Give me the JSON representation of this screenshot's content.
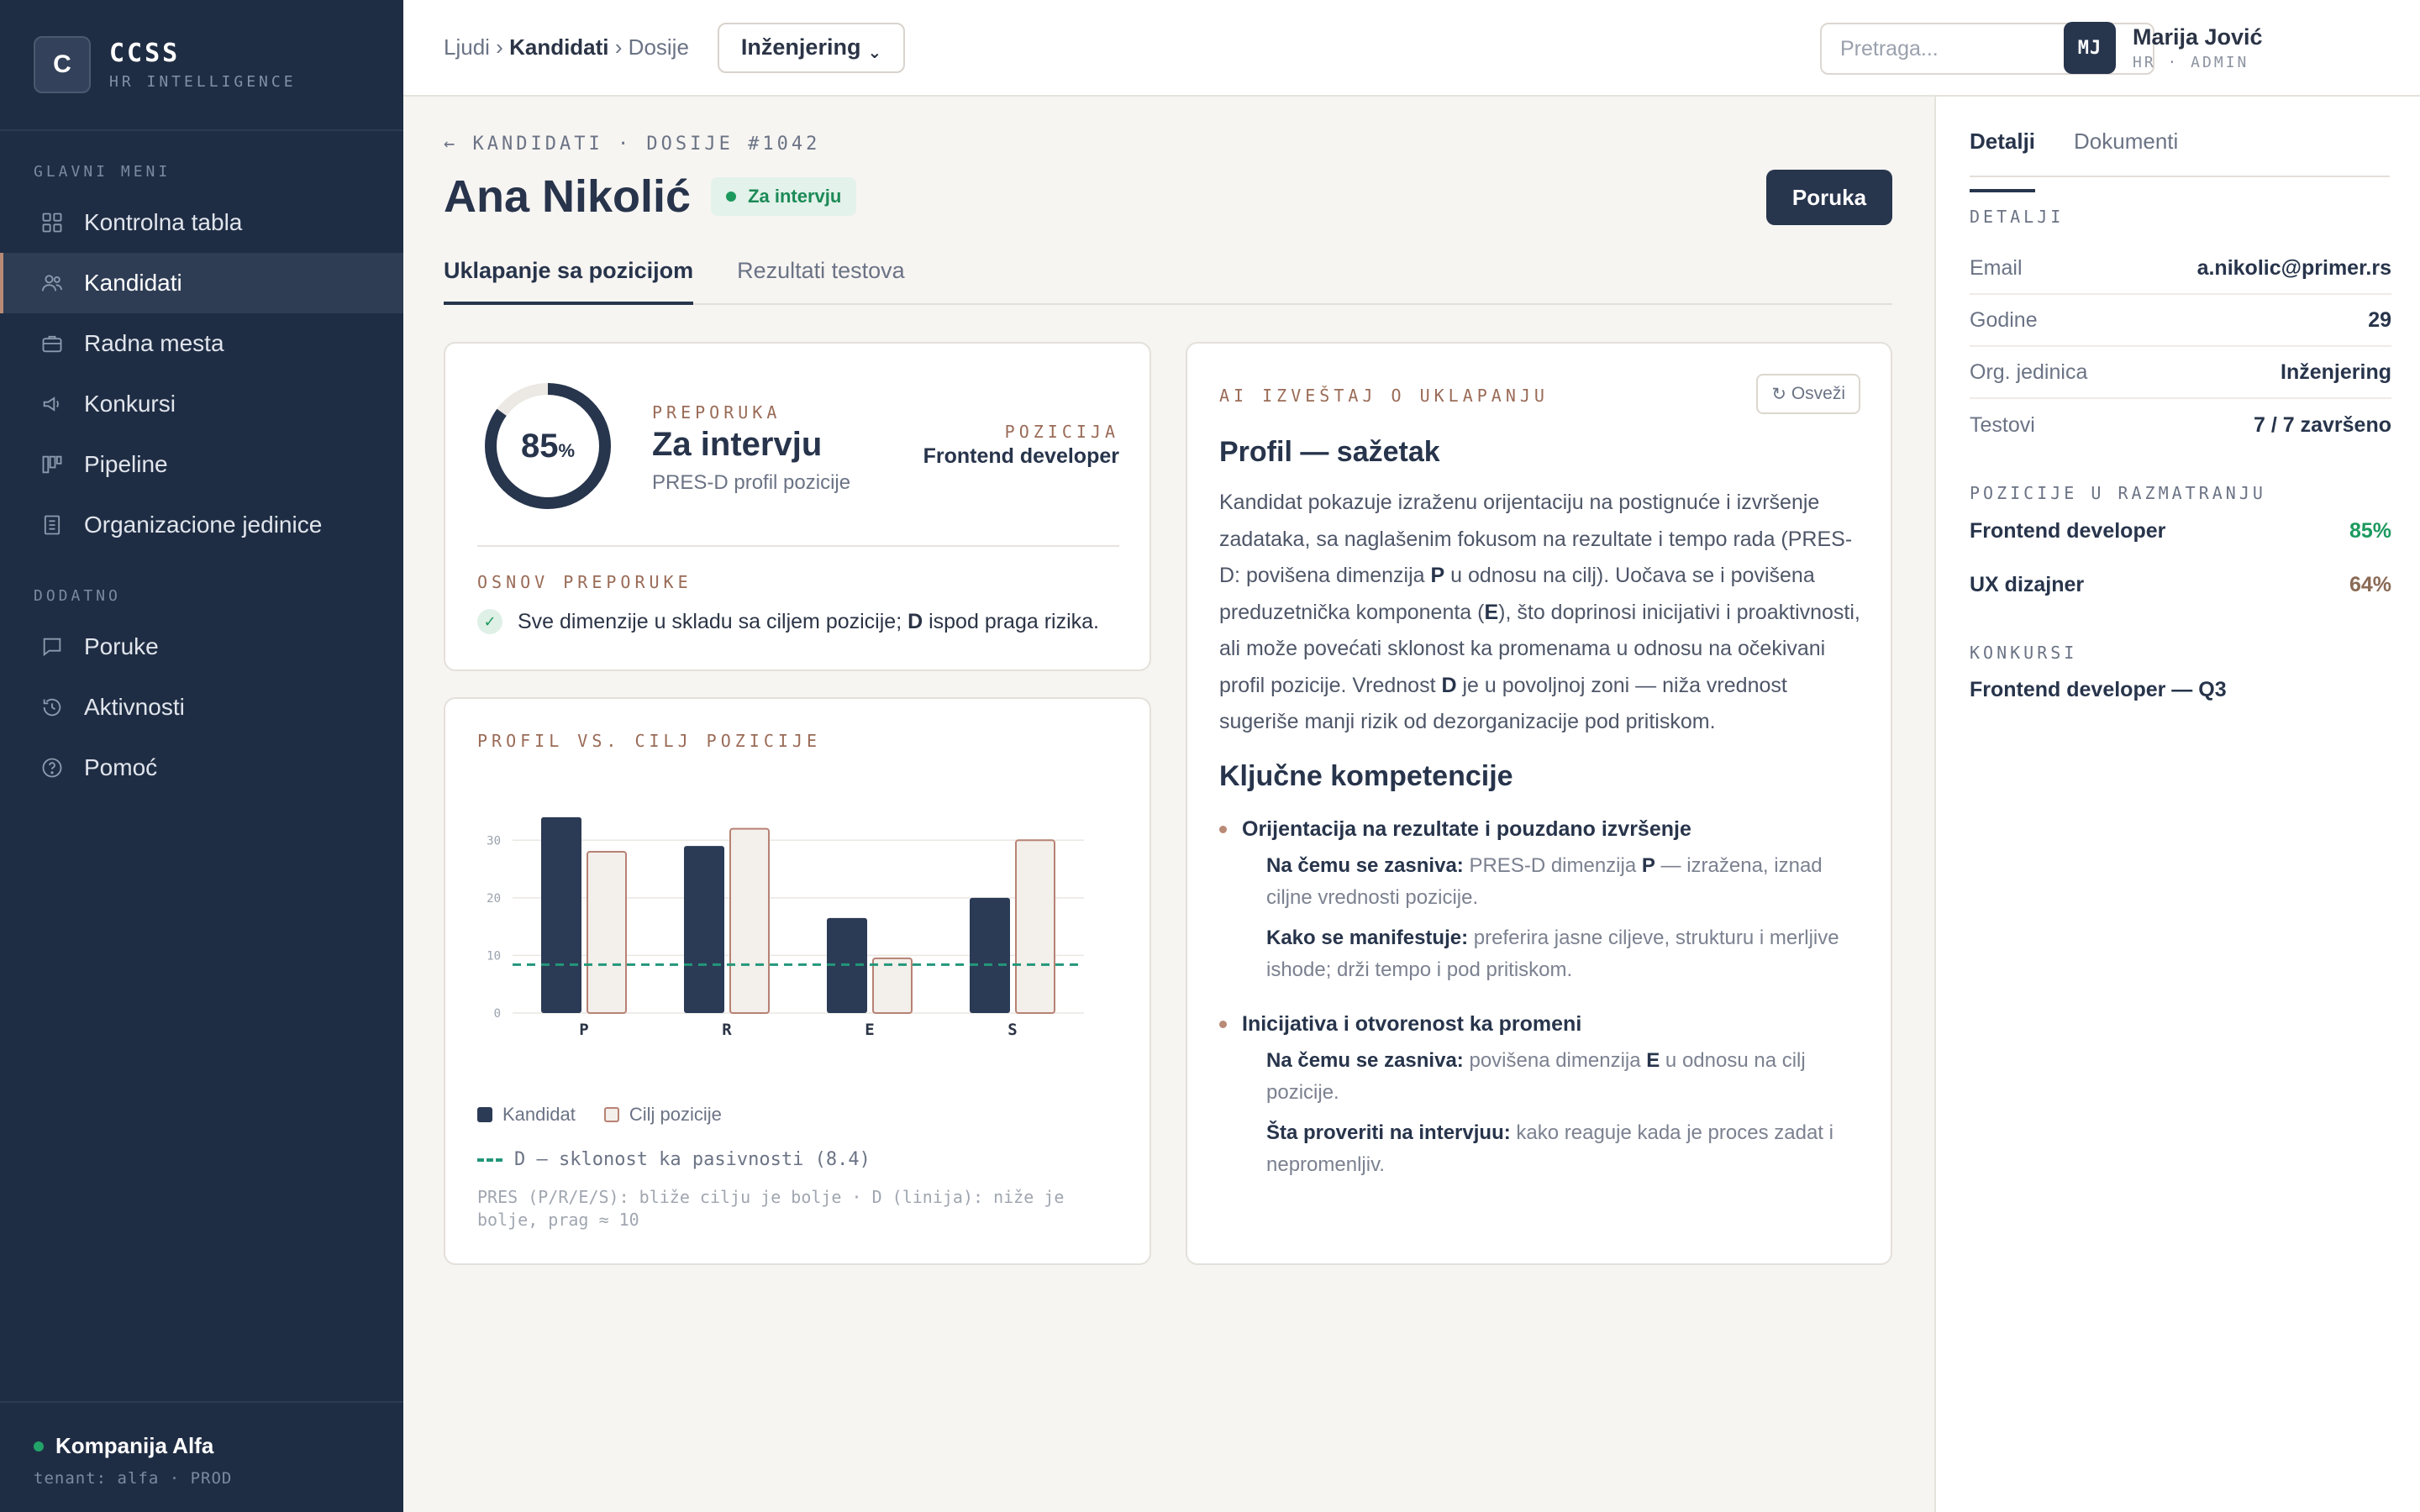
{
  "brand": {
    "logo_letter": "C",
    "name": "CCSS",
    "subtitle": "HR INTELLIGENCE"
  },
  "sidebar": {
    "section_main": "GLAVNI MENI",
    "main_items": [
      {
        "label": "Kontrolna tabla",
        "icon": "grid-icon"
      },
      {
        "label": "Kandidati",
        "icon": "users-icon",
        "active": true
      },
      {
        "label": "Radna mesta",
        "icon": "briefcase-icon"
      },
      {
        "label": "Konkursi",
        "icon": "megaphone-icon"
      },
      {
        "label": "Pipeline",
        "icon": "kanban-icon"
      },
      {
        "label": "Organizacione jedinice",
        "icon": "building-icon"
      }
    ],
    "section_extra": "DODATNO",
    "extra_items": [
      {
        "label": "Poruke",
        "icon": "message-icon"
      },
      {
        "label": "Aktivnosti",
        "icon": "history-icon"
      },
      {
        "label": "Pomoć",
        "icon": "help-icon"
      }
    ],
    "company": "Kompanija Alfa",
    "tenant": "tenant: alfa · PROD"
  },
  "topbar": {
    "crumb_1": "Ljudi",
    "crumb_2": "Kandidati",
    "crumb_3": "Dosije",
    "sep": "›",
    "department": "Inženjering",
    "search_placeholder": "Pretraga...",
    "user_initials": "MJ",
    "user_name": "Marija Jović",
    "user_role": "HR · ADMIN"
  },
  "header": {
    "back_line": "← KANDIDATI · DOSIJE #1042",
    "name": "Ana Nikolić",
    "status": "Za intervju",
    "message_button": "Poruka",
    "tabs": [
      "Uklapanje sa pozicijom",
      "Rezultati testova"
    ]
  },
  "recommendation": {
    "score": 85,
    "score_unit": "%",
    "label": "PREPORUKA",
    "value": "Za intervju",
    "profile": "PRES-D profil pozicije",
    "position_label": "POZICIJA",
    "position_value": "Frontend developer",
    "basis_label": "OSNOV PREPORUKE",
    "basis_text_1": "Sve dimenzije u skladu sa ciljem pozicije; ",
    "basis_bold": "D",
    "basis_text_2": " ispod praga rizika."
  },
  "chart_data": {
    "type": "bar",
    "title": "PROFIL VS. CILJ POZICIJE",
    "categories": [
      "P",
      "R",
      "E",
      "S"
    ],
    "series": [
      {
        "name": "Kandidat",
        "values": [
          34,
          29,
          16.5,
          20
        ]
      },
      {
        "name": "Cilj pozicije",
        "values": [
          28,
          32,
          9.5,
          30
        ]
      }
    ],
    "reference_line": {
      "name": "D — sklonost ka pasivnosti (8.4)",
      "value": 8.4
    },
    "yticks": [
      0,
      10,
      20,
      30
    ],
    "ylim": [
      0,
      35
    ],
    "grid": true,
    "legend_position": "bottom",
    "note": "PRES (P/R/E/S): bliže cilju je bolje · D (linija): niže je bolje, prag ≈ 10",
    "colors": {
      "candidate": "#2b3a55",
      "target_fill": "#f3efea",
      "target_stroke": "#b78274",
      "reference": "#23977a"
    }
  },
  "ai_report": {
    "label": "AI IZVEŠTAJ O UKLAPANJU",
    "refresh": "Osveži",
    "summary_title": "Profil — sažetak",
    "summary_parts": [
      "Kandidat pokazuje izraženu orijentaciju na postignuće i izvršenje zadataka, sa naglašenim fokusom na rezultate i tempo rada (PRES-D: povišena dimenzija ",
      "P",
      " u odnosu na cilj). Uočava se i povišena preduzetnička komponenta (",
      "E",
      "), što doprinosi inicijativi i proaktivnosti, ali može povećati sklonost ka promenama u odnosu na očekivani profil pozicije. Vrednost ",
      "D",
      " je u povoljnoj zoni — niža vrednost sugeriše manji rizik od dezorganizacije pod pritiskom."
    ],
    "competencies_title": "Ključne kompetencije",
    "competencies": [
      {
        "title": "Orijentacija na rezultate i pouzdano izvršenje",
        "k1": "Na čemu se zasniva:",
        "t1a": " PRES-D dimenzija ",
        "t1b": "P",
        "t1c": " — izražena, iznad ciljne vrednosti pozicije.",
        "k2": "Kako se manifestuje:",
        "t2": " preferira jasne ciljeve, strukturu i merljive ishode; drži tempo i pod pritiskom."
      },
      {
        "title": "Inicijativa i otvorenost ka promeni",
        "k1": "Na čemu se zasniva:",
        "t1a": " povišena dimenzija ",
        "t1b": "E",
        "t1c": " u odnosu na cilj pozicije.",
        "k2": "Šta proveriti na intervjuu:",
        "t2": " kako reaguje kada je proces zadat i nepromenljiv."
      }
    ]
  },
  "details_panel": {
    "tabs": [
      "Detalji",
      "Dokumenti"
    ],
    "details_label": "DETALJI",
    "fields": [
      {
        "key": "Email",
        "value": "a.nikolic@primer.rs"
      },
      {
        "key": "Godine",
        "value": "29"
      },
      {
        "key": "Org. jedinica",
        "value": "Inženjering"
      },
      {
        "key": "Testovi",
        "value": "7 / 7 završeno"
      }
    ],
    "positions_label": "POZICIJE U RAZMATRANJU",
    "positions": [
      {
        "name": "Frontend developer",
        "pct": "85%"
      },
      {
        "name": "UX dizajner",
        "pct": "64%"
      }
    ],
    "contests_label": "KONKURSI",
    "contest": "Frontend developer — Q3"
  }
}
